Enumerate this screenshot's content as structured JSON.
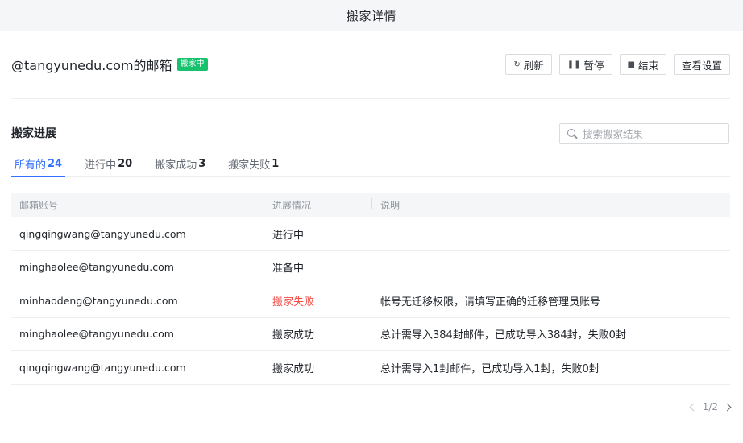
{
  "window": {
    "title": "搬家详情"
  },
  "mailbox": {
    "name": "@tangyunedu.com的邮箱",
    "status_badge": "搬家中"
  },
  "actions": {
    "refresh": "刷新",
    "pause": "暂停",
    "end": "结束",
    "view_settings": "查看设置"
  },
  "progress": {
    "title": "搬家进展",
    "search_placeholder": "搜索搬家结果",
    "tabs": [
      {
        "label": "所有的",
        "count": "24"
      },
      {
        "label": "进行中",
        "count": "20"
      },
      {
        "label": "搬家成功",
        "count": "3"
      },
      {
        "label": "搬家失败",
        "count": "1"
      }
    ],
    "active_tab": 0
  },
  "table": {
    "columns": [
      "邮箱账号",
      "进展情况",
      "说明"
    ],
    "rows": [
      {
        "account": "qingqingwang@tangyunedu.com",
        "status": "进行中",
        "note": "–"
      },
      {
        "account": "minghaolee@tangyunedu.com",
        "status": "准备中",
        "note": "–"
      },
      {
        "account": "minhaodeng@tangyunedu.com",
        "status": "搬家失败",
        "note": "帐号无迁移权限，请填写正确的迁移管理员账号"
      },
      {
        "account": "minghaolee@tangyunedu.com",
        "status": "搬家成功",
        "note": "总计需导入384封邮件，已成功导入384封，失败0封"
      },
      {
        "account": "qingqingwang@tangyunedu.com",
        "status": "搬家成功",
        "note": "总计需导入1封邮件，已成功导入1封，失败0封"
      }
    ]
  },
  "pagination": {
    "text": "1/2"
  },
  "colors": {
    "accent": "#3370ff",
    "success_badge": "#18c16d",
    "failed": "#f54a45"
  }
}
